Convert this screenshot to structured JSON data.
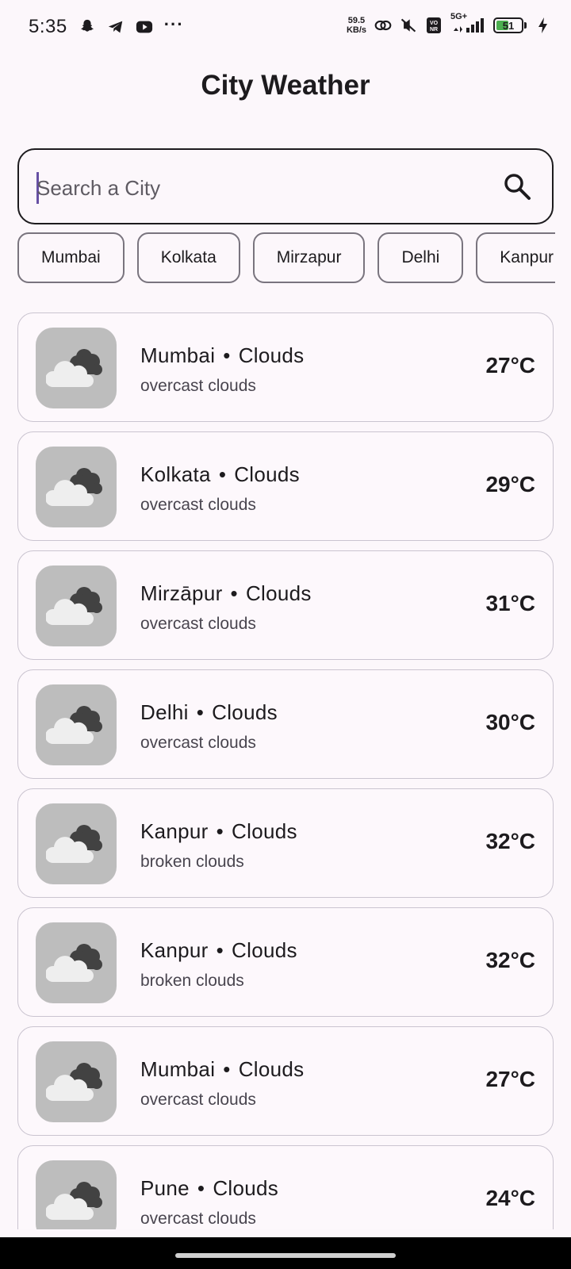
{
  "status_bar": {
    "time": "5:35",
    "net_speed_value": "59.5",
    "net_speed_unit": "KB/s",
    "network": "5G+",
    "battery_level": "51",
    "icons": [
      "snapchat-icon",
      "telegram-icon",
      "youtube-icon",
      "more-icon",
      "link-icon",
      "mute-icon",
      "vonr-icon",
      "signal-icon",
      "battery-icon",
      "charging-icon"
    ]
  },
  "header": {
    "title": "City Weather"
  },
  "search": {
    "placeholder": "Search a City",
    "value": ""
  },
  "chips": [
    "Mumbai",
    "Kolkata",
    "Mirzapur",
    "Delhi",
    "Kanpur"
  ],
  "weather_list": [
    {
      "city": "Mumbai",
      "condition": "Clouds",
      "description": "overcast clouds",
      "temp": "27°C"
    },
    {
      "city": "Kolkata",
      "condition": "Clouds",
      "description": "overcast clouds",
      "temp": "29°C"
    },
    {
      "city": "Mirzāpur",
      "condition": "Clouds",
      "description": "overcast clouds",
      "temp": "31°C"
    },
    {
      "city": "Delhi",
      "condition": "Clouds",
      "description": "overcast clouds",
      "temp": "30°C"
    },
    {
      "city": "Kanpur",
      "condition": "Clouds",
      "description": "broken clouds",
      "temp": "32°C"
    },
    {
      "city": "Kanpur",
      "condition": "Clouds",
      "description": "broken clouds",
      "temp": "32°C"
    },
    {
      "city": "Mumbai",
      "condition": "Clouds",
      "description": "overcast clouds",
      "temp": "27°C"
    },
    {
      "city": "Pune",
      "condition": "Clouds",
      "description": "overcast clouds",
      "temp": "24°C"
    }
  ],
  "bullet": "•",
  "colors": {
    "background": "#fcf7fb",
    "text": "#1d1b1e",
    "icon_tile": "#bdbdbd",
    "cursor": "#6750a4",
    "battery_fill": "#4caf50"
  }
}
